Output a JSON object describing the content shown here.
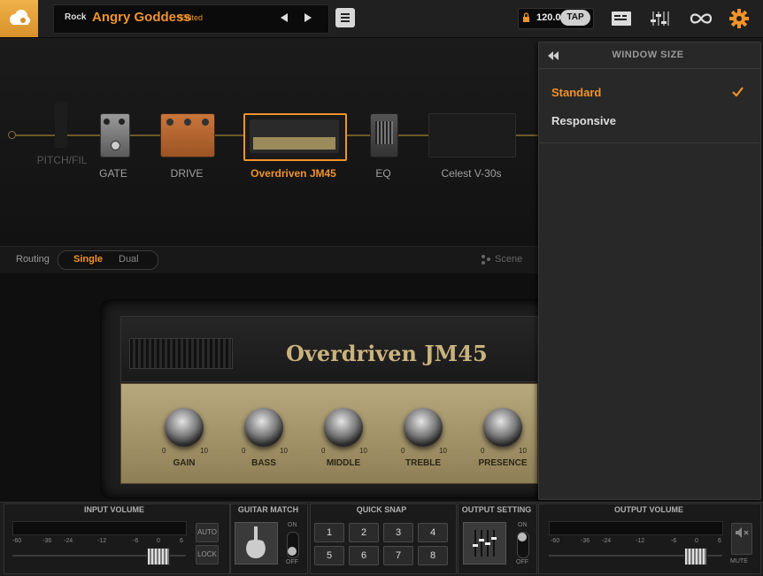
{
  "topbar": {
    "genre": "Rock",
    "preset_name": "Angry Goddess",
    "edited_tag": "*Edited",
    "bpm": "120.0",
    "tap_label": "TAP"
  },
  "chain": {
    "items": [
      {
        "label": "PITCH/FIL",
        "active": false
      },
      {
        "label": "GATE",
        "active": false
      },
      {
        "label": "DRIVE",
        "active": false
      },
      {
        "label": "Overdriven JM45",
        "active": true
      },
      {
        "label": "EQ",
        "active": false
      },
      {
        "label": "Celest V-30s",
        "active": false
      }
    ]
  },
  "routing": {
    "label": "Routing",
    "options": [
      "Single",
      "Dual"
    ],
    "selected": "Single",
    "scene_label": "Scene"
  },
  "amp": {
    "name": "Overdriven JM45",
    "knobs": [
      {
        "label": "GAIN",
        "min": "0",
        "max": "10"
      },
      {
        "label": "BASS",
        "min": "0",
        "max": "10"
      },
      {
        "label": "MIDDLE",
        "min": "0",
        "max": "10"
      },
      {
        "label": "TREBLE",
        "min": "0",
        "max": "10"
      },
      {
        "label": "PRESENCE",
        "min": "0",
        "max": "10"
      }
    ]
  },
  "window_size_menu": {
    "title": "WINDOW SIZE",
    "options": [
      "Standard",
      "Responsive"
    ],
    "selected": "Standard"
  },
  "bottom": {
    "input_volume": {
      "title": "INPUT VOLUME",
      "scale": [
        "-60",
        "-36",
        "-24",
        "-12",
        "-6",
        "0",
        "6"
      ],
      "auto_label": "AUTO",
      "lock_label": "LOCK"
    },
    "guitar_match": {
      "title": "GUITAR MATCH",
      "on_label": "ON",
      "off_label": "OFF"
    },
    "quick_snap": {
      "title": "QUICK SNAP",
      "buttons": [
        "1",
        "2",
        "3",
        "4",
        "5",
        "6",
        "7",
        "8"
      ]
    },
    "output_setting": {
      "title": "OUTPUT SETTING",
      "on_label": "ON",
      "off_label": "OFF"
    },
    "output_volume": {
      "title": "OUTPUT VOLUME",
      "scale": [
        "-60",
        "-36",
        "-24",
        "-12",
        "-6",
        "0",
        "6"
      ],
      "mute_label": "MUTE"
    }
  },
  "colors": {
    "accent": "#f0932a",
    "background": "#161616"
  },
  "icons": {
    "logo": "cloud-logo-icon",
    "prev": "triangle-left-icon",
    "next": "triangle-right-icon",
    "menu": "list-icon",
    "lock": "lock-icon",
    "settings": "gear-icon",
    "loop": "infinity-icon",
    "mixer": "sliders-icon",
    "tuner": "screen-icon",
    "check": "check-icon",
    "collapse": "double-left-arrow-icon"
  }
}
